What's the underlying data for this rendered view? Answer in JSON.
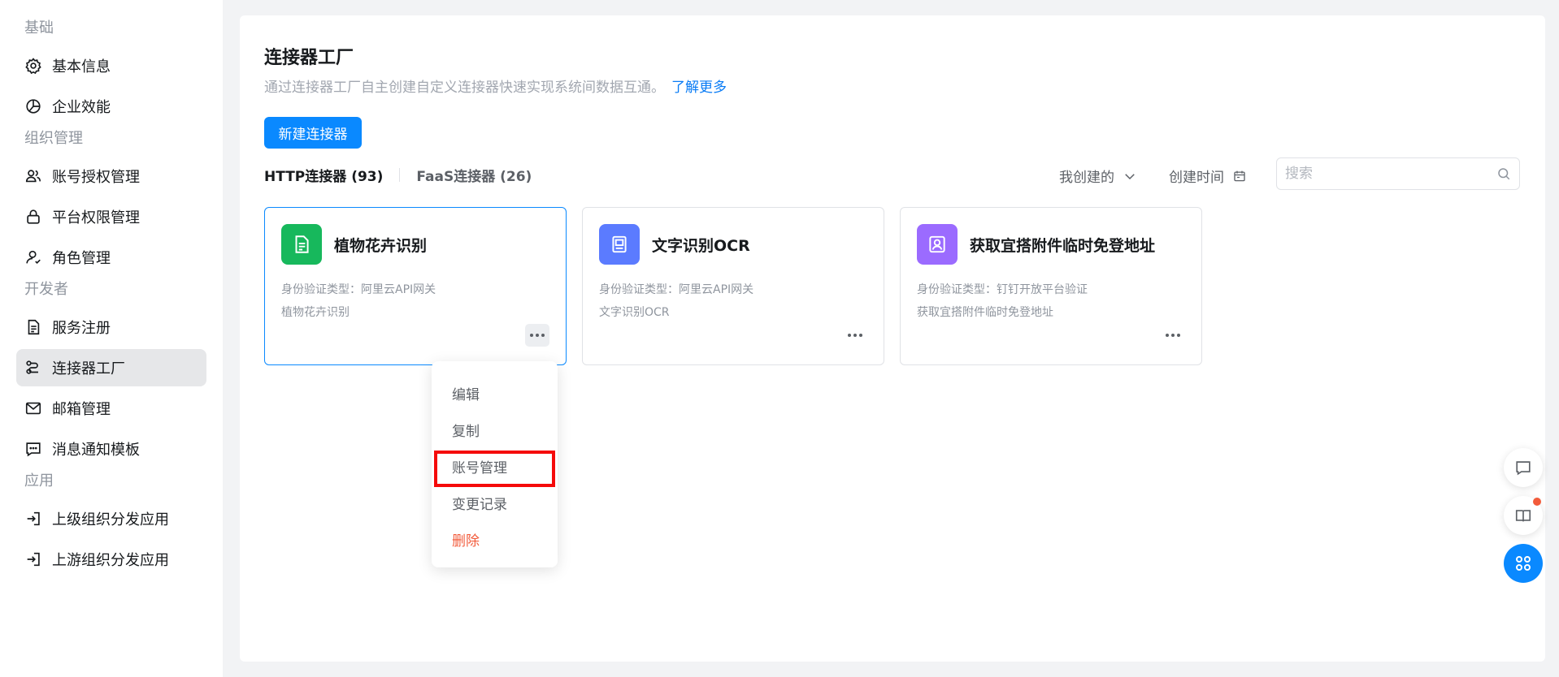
{
  "sidebar": {
    "sections": [
      {
        "title": "基础",
        "items": [
          {
            "label": "基本信息",
            "icon": "gear-icon"
          },
          {
            "label": "企业效能",
            "icon": "pie-chart-icon"
          }
        ]
      },
      {
        "title": "组织管理",
        "items": [
          {
            "label": "账号授权管理",
            "icon": "users-icon"
          },
          {
            "label": "平台权限管理",
            "icon": "lock-icon"
          },
          {
            "label": "角色管理",
            "icon": "user-icon"
          }
        ]
      },
      {
        "title": "开发者",
        "items": [
          {
            "label": "服务注册",
            "icon": "document-icon"
          },
          {
            "label": "连接器工厂",
            "icon": "connector-icon",
            "active": true
          },
          {
            "label": "邮箱管理",
            "icon": "mail-icon"
          },
          {
            "label": "消息通知模板",
            "icon": "message-icon"
          }
        ]
      },
      {
        "title": "应用",
        "items": [
          {
            "label": "上级组织分发应用",
            "icon": "login-icon"
          },
          {
            "label": "上游组织分发应用",
            "icon": "login-icon"
          }
        ]
      }
    ]
  },
  "header": {
    "title": "连接器工厂",
    "description": "通过连接器工厂自主创建自定义连接器快速实现系统间数据互通。",
    "learn_more": "了解更多",
    "new_button": "新建连接器"
  },
  "tabs": [
    {
      "label": "HTTP连接器 (93)",
      "active": true
    },
    {
      "label": "FaaS连接器 (26)",
      "active": false
    }
  ],
  "filters": {
    "creator": "我创建的",
    "sort": "创建时间",
    "search_placeholder": "搜索"
  },
  "cards": [
    {
      "name": "植物花卉识别",
      "auth": "身份验证类型：阿里云API网关",
      "desc": "植物花卉识别",
      "icon": "document-icon",
      "color": "#17b85c",
      "selected": true
    },
    {
      "name": "文字识别OCR",
      "auth": "身份验证类型：阿里云API网关",
      "desc": "文字识别OCR",
      "icon": "ocr-icon",
      "color": "#5b7bff",
      "selected": false
    },
    {
      "name": "获取宜搭附件临时免登地址",
      "auth": "身份验证类型：钉钉开放平台验证",
      "desc": "获取宜搭附件临时免登地址",
      "icon": "person-icon",
      "color": "#9b6bff",
      "selected": false
    }
  ],
  "menu": {
    "items": [
      {
        "label": "编辑"
      },
      {
        "label": "复制"
      },
      {
        "label": "账号管理",
        "highlighted": true
      },
      {
        "label": "变更记录"
      },
      {
        "label": "删除",
        "danger": true
      }
    ]
  },
  "colors": {
    "accent": "#0a89ff",
    "danger": "#f25b3b",
    "highlight_box": "#f50a0a"
  }
}
